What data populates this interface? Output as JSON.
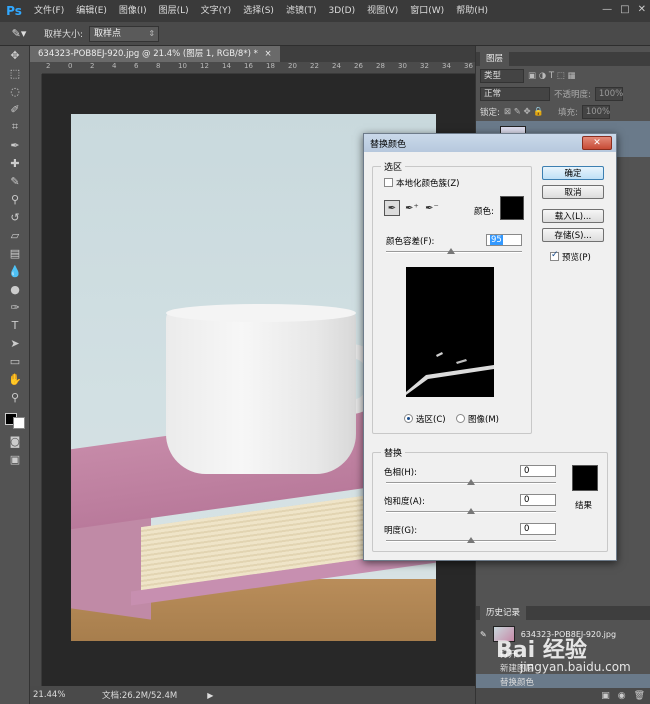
{
  "app": {
    "logo": "Ps"
  },
  "menu": [
    "文件(F)",
    "编辑(E)",
    "图像(I)",
    "图层(L)",
    "文字(Y)",
    "选择(S)",
    "滤镜(T)",
    "3D(D)",
    "视图(V)",
    "窗口(W)",
    "帮助(H)"
  ],
  "window_controls": {
    "minimize": "—",
    "maximize": "□",
    "close": "✕"
  },
  "options_bar": {
    "sample_size_label": "取样大小:",
    "sample_size_value": "取样点"
  },
  "document": {
    "tab_title": "634323-POB8EJ-920.jpg @ 21.4% (图层 1, RGB/8*) *",
    "tab_close": "×",
    "ruler_numbers": [
      "2",
      "0",
      "2",
      "4",
      "6",
      "8",
      "10",
      "12",
      "14",
      "16",
      "18",
      "20",
      "22",
      "24",
      "26",
      "28",
      "30",
      "32",
      "34",
      "36"
    ]
  },
  "status": {
    "zoom": "21.44%",
    "doc_info": "文档:26.2M/52.4M"
  },
  "layers_panel": {
    "tab": "图层",
    "filter_select": "类型",
    "blend_mode": "正常",
    "opacity_label": "不透明度:",
    "opacity_value": "100%",
    "lock_label": "锁定:",
    "fill_label": "填充:",
    "fill_value": "100%"
  },
  "history_panel": {
    "tab": "历史记录",
    "snapshot": "634323-POB8EJ-920.jpg",
    "items": [
      "打开",
      "新建图层",
      "替换颜色"
    ]
  },
  "dialog": {
    "title": "替换颜色",
    "close": "✕",
    "selection_group": "选区",
    "localized_clusters_label": "本地化颜色簇(Z)",
    "localized_clusters_checked": false,
    "color_label": "颜色:",
    "fuzziness_label": "颜色容差(F):",
    "fuzziness_value": "95",
    "fuzziness_fraction": 0.475,
    "radio_selection": "选区(C)",
    "radio_image": "图像(M)",
    "replacement_group": "替换",
    "hue_label": "色相(H):",
    "hue_value": "0",
    "saturation_label": "饱和度(A):",
    "saturation_value": "0",
    "lightness_label": "明度(G):",
    "lightness_value": "0",
    "result_label": "结果",
    "buttons": {
      "ok": "确定",
      "cancel": "取消",
      "load": "载入(L)...",
      "save": "存储(S)..."
    },
    "preview_label": "预览(P)",
    "preview_checked": true
  },
  "watermark": {
    "brand": "Bai 经验",
    "site": "jingyan.baidu.com"
  }
}
